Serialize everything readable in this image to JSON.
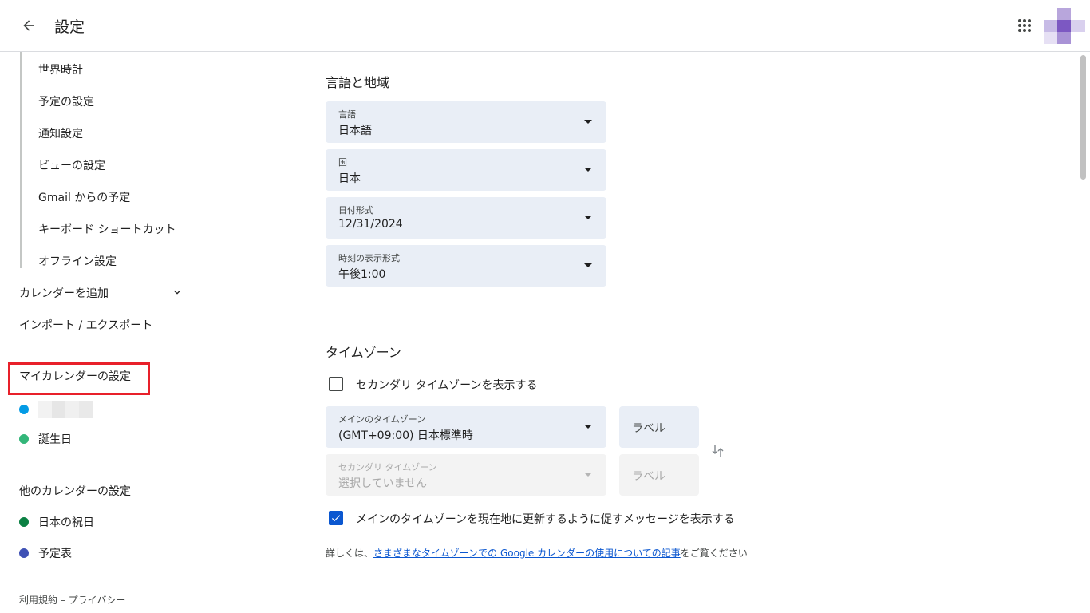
{
  "header": {
    "title": "設定",
    "back_icon": "arrow-back-icon",
    "apps_icon": "apps-grid-icon"
  },
  "sidebar": {
    "sub_items": [
      "世界時計",
      "予定の設定",
      "通知設定",
      "ビューの設定",
      "Gmail からの予定",
      "キーボード ショートカット",
      "オフライン設定"
    ],
    "add_calendar": "カレンダーを追加",
    "import_export": "インポート / エクスポート",
    "my_calendars_heading": "マイカレンダーの設定",
    "my_calendars": [
      {
        "label": "",
        "color": "#039be5"
      },
      {
        "label": "誕生日",
        "color": "#33b679"
      }
    ],
    "other_calendars_heading": "他のカレンダーの設定",
    "other_calendars": [
      {
        "label": "日本の祝日",
        "color": "#0b8043"
      },
      {
        "label": "予定表",
        "color": "#3f51b5"
      }
    ],
    "footer": {
      "terms": "利用規約",
      "separator": "–",
      "privacy": "プライバシー"
    }
  },
  "language_region": {
    "heading": "言語と地域",
    "fields": [
      {
        "label": "言語",
        "value": "日本語"
      },
      {
        "label": "国",
        "value": "日本"
      },
      {
        "label": "日付形式",
        "value": "12/31/2024"
      },
      {
        "label": "時刻の表示形式",
        "value": "午後1:00"
      }
    ]
  },
  "timezone": {
    "heading": "タイムゾーン",
    "show_secondary": {
      "label": "セカンダリ タイムゾーンを表示する",
      "checked": false
    },
    "primary": {
      "label": "メインのタイムゾーン",
      "value": "(GMT+09:00) 日本標準時",
      "label_field": "ラベル"
    },
    "secondary": {
      "label": "セカンダリ タイムゾーン",
      "value": "選択していません",
      "label_field": "ラベル"
    },
    "prompt_update": {
      "label": "メインのタイムゾーンを現在地に更新するように促すメッセージを表示する",
      "checked": true
    },
    "help": {
      "prefix": "詳しくは、",
      "link": "さまざまなタイムゾーンでの Google カレンダーの使用についての記事",
      "suffix": "をご覧ください"
    }
  },
  "colors": {
    "accent": "#0b57d0",
    "highlight": "#e8202a",
    "field_bg": "#e9eef6"
  }
}
